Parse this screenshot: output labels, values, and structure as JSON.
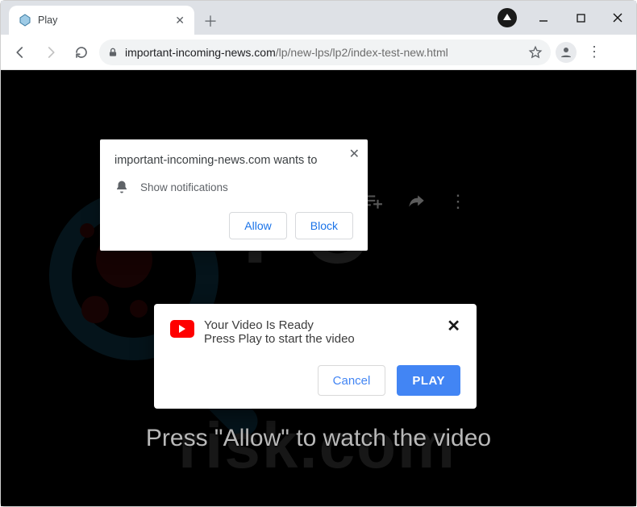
{
  "tab": {
    "title": "Play"
  },
  "url": {
    "host": "important-incoming-news.com",
    "path": "/lp/new-lps/lp2/index-test-new.html"
  },
  "notification_prompt": {
    "heading": "important-incoming-news.com wants to",
    "body": "Show notifications",
    "allow": "Allow",
    "block": "Block"
  },
  "video_popup": {
    "title": "Your Video Is Ready",
    "subtitle": "Press Play to start the video",
    "cancel": "Cancel",
    "play": "PLAY"
  },
  "page": {
    "instruction": "Press \"Allow\" to watch the video"
  },
  "watermark": {
    "line1": "PC",
    "line2": "risk.com"
  }
}
